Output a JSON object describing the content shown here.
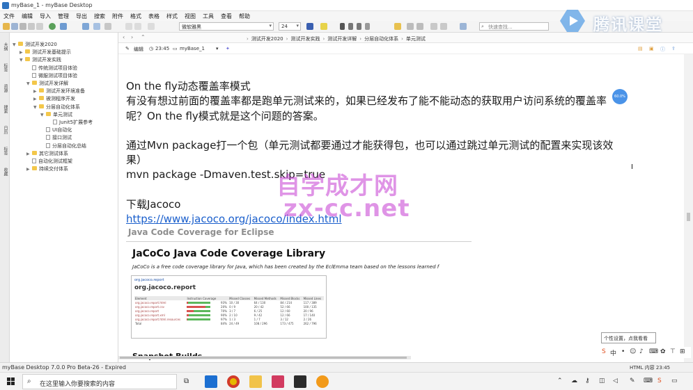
{
  "window": {
    "title": "myBase_1 - myBase Desktop"
  },
  "menu": [
    "文件",
    "编辑",
    "导入",
    "管理",
    "导出",
    "搜索",
    "附件",
    "格式",
    "表格",
    "样式",
    "视图",
    "工具",
    "查看",
    "帮助"
  ],
  "toolbar": {
    "font_name": "微软雅黑",
    "font_size": "24",
    "search_placeholder": "快速查找..."
  },
  "brand_watermark": "腾讯课堂",
  "left_tabs": [
    "大纲",
    "标签",
    "资源",
    "搜索",
    "日历",
    "标签",
    "收藏"
  ],
  "tree": [
    {
      "label": "测试开发2020",
      "level": 0,
      "type": "folder",
      "toggle": "▼"
    },
    {
      "label": "测试开发基础提示",
      "level": 1,
      "type": "folder",
      "toggle": "▶"
    },
    {
      "label": "测试开发实践",
      "level": 1,
      "type": "folder",
      "toggle": "▼"
    },
    {
      "label": "传统测试项目体验",
      "level": 2,
      "type": "doc",
      "toggle": ""
    },
    {
      "label": "微服测试项目体验",
      "level": 2,
      "type": "doc",
      "toggle": ""
    },
    {
      "label": "测试开发详解",
      "level": 2,
      "type": "folder",
      "toggle": "▼"
    },
    {
      "label": "测试开发环境准备",
      "level": 3,
      "type": "folder",
      "toggle": "▶"
    },
    {
      "label": "被测程序开发",
      "level": 3,
      "type": "folder",
      "toggle": "▶"
    },
    {
      "label": "分层自动化体系",
      "level": 3,
      "type": "folder",
      "toggle": "▼"
    },
    {
      "label": "单元测试",
      "level": 4,
      "type": "folder",
      "toggle": "▼"
    },
    {
      "label": "Junit5扩展参考",
      "level": 5,
      "type": "doc",
      "toggle": ""
    },
    {
      "label": "UI自动化",
      "level": 4,
      "type": "doc",
      "toggle": ""
    },
    {
      "label": "接口测试",
      "level": 4,
      "type": "doc",
      "toggle": ""
    },
    {
      "label": "分层自动化总结",
      "level": 4,
      "type": "doc",
      "toggle": ""
    },
    {
      "label": "其它测试体系",
      "level": 2,
      "type": "folder",
      "toggle": "▶"
    },
    {
      "label": "自动化测试框架",
      "level": 2,
      "type": "doc",
      "toggle": ""
    },
    {
      "label": "持续交付体系",
      "level": 2,
      "type": "folder",
      "toggle": "▶"
    }
  ],
  "breadcrumbs": [
    "测试开发2020",
    "测试开发实践",
    "测试开发详解",
    "分层自动化体系",
    "单元测试"
  ],
  "docbar": {
    "edit_label": "编辑",
    "time": "23:45",
    "db_name": "myBase_1"
  },
  "content": {
    "heading": "On the fly动态覆盖率模式",
    "para1_line1": "有没有想过前面的覆盖率都是跑单元测试来的，如果已经发布了能不能动态的获取用户访问系统的覆盖率",
    "para1_line2": "呢？On the fly模式就是这个问题的答案。",
    "para2_line1": "通过Mvn package打一个包（单元测试都要通过才能获得包，也可以通过跳过单元测试的配置来实现该效",
    "para2_line2": "果）",
    "command": "mvn package -Dmaven.test.skip=true",
    "download": "下载Jacoco",
    "link": "https://www.jacoco.org/jacoco/index.html"
  },
  "overlay_watermark": {
    "cn": "自学成才网",
    "en": "zx-cc.net"
  },
  "embed": {
    "page_header": "Java Code Coverage for Eclipse",
    "title": "JaCoCo Java Code Coverage Library",
    "description": "JaCoCo is a free code coverage library for Java, which has been created by the EclEmma team based on the lessons learned f",
    "breadcrumb": "org.jacoco.report",
    "report_title": "org.jacoco.report",
    "table_headers": [
      "Element",
      "Instruction Coverage",
      "",
      "Missed Classes",
      "Missed Methods",
      "Missed Blocks",
      "Missed Lines"
    ],
    "table_rows": [
      [
        "org.jacoco.report.html",
        "93%",
        "10 / 30",
        "64 / 130",
        "84 / 214",
        "117 / 389",
        0.93
      ],
      [
        "org.jacoco.report.csv",
        "20%",
        "0 / 9",
        "20 / 42",
        "52 / 66",
        "100 / 135",
        0.2
      ],
      [
        "org.jacoco.report",
        "70%",
        "3 / 7",
        "6 / 25",
        "12 / 60",
        "20 / 96",
        0.7
      ],
      [
        "org.jacoco.report.xml",
        "90%",
        "2 / 10",
        "9 / 42",
        "12 / 66",
        "17 / 140",
        0.9
      ],
      [
        "org.jacoco.report.html.resources",
        "97%",
        "1 / 3",
        "1 / 7",
        "3 / 12",
        "2 / 26",
        0.97
      ]
    ],
    "total_row": [
      "Total",
      "84%",
      "24 / 49",
      "108 / 296",
      "173 / 475",
      "262 / 796"
    ],
    "next_heading": "Snapshot Builds"
  },
  "bubble_label": "60.0%",
  "tooltip": "个性设置，点我看看",
  "statusbar": {
    "left": "myBase Desktop 7.0.0 Pro Beta-26 - Expired",
    "right": "HTML 内容  23:45"
  },
  "taskbar": {
    "search_placeholder": "在这里输入你要搜索的内容"
  },
  "colors": {
    "link": "#1a5fcc",
    "folder": "#f3c74a",
    "watermark": "#c43cd2",
    "bubble": "#4a93e8"
  }
}
